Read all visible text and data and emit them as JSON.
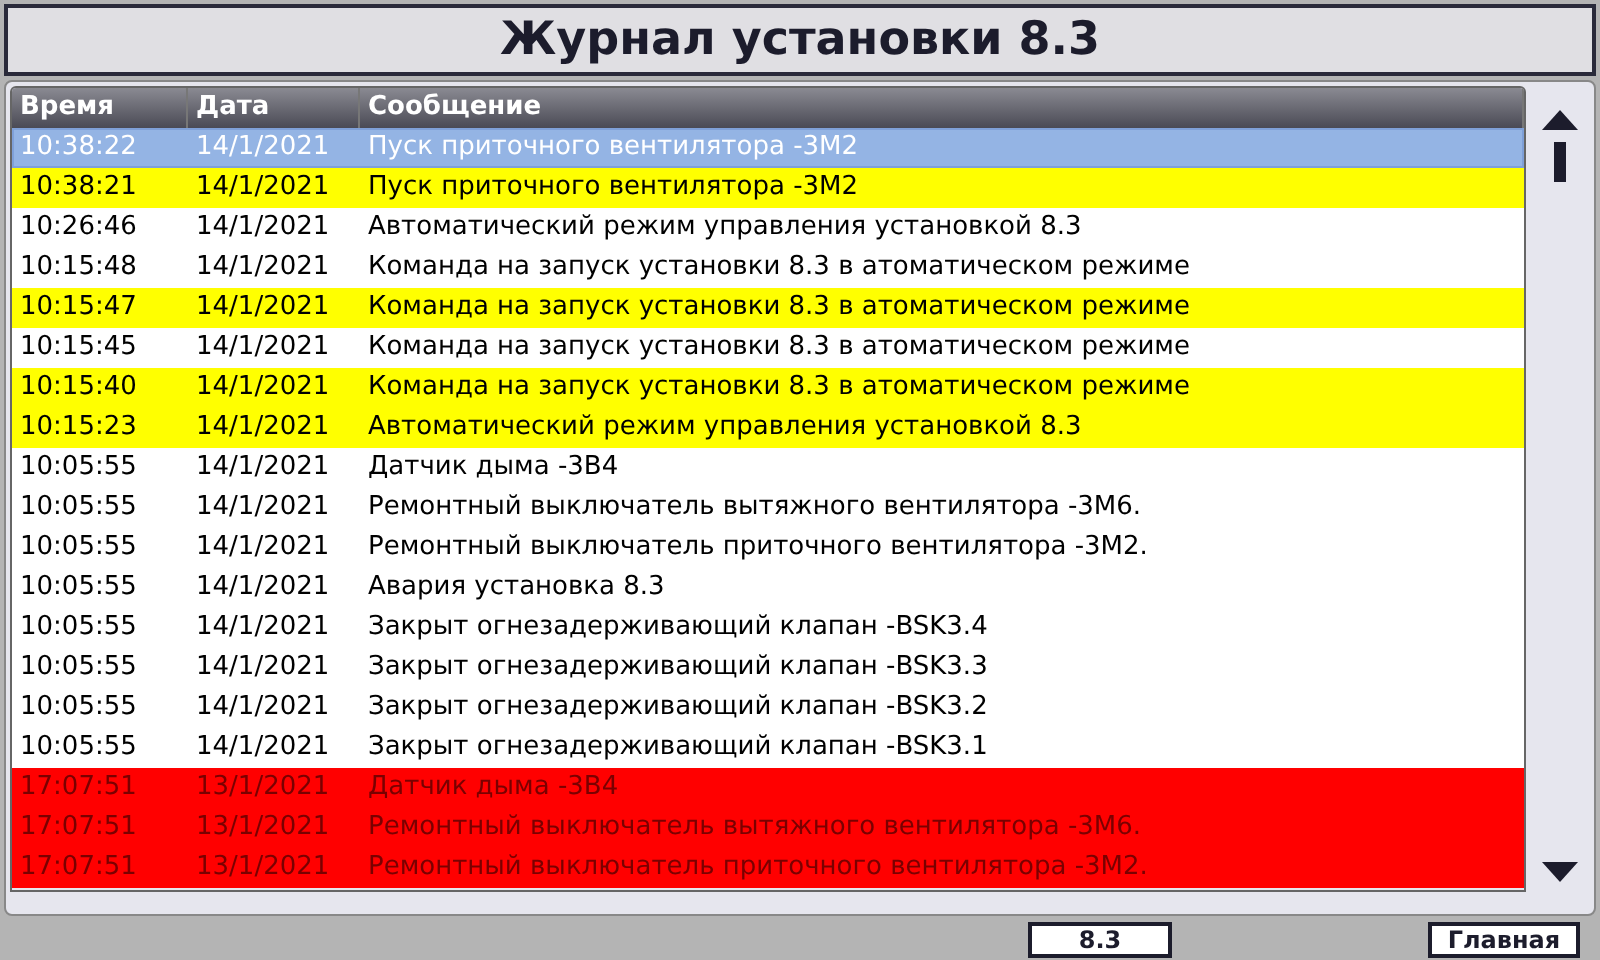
{
  "window": {
    "title": "Журнал установки 8.3"
  },
  "table": {
    "columns": [
      "Время",
      "Дата",
      "Сообщение"
    ],
    "rows": [
      {
        "cells": [
          "10:38:22",
          "14/1/2021",
          "Пуск приточного вентилятора -3М2"
        ],
        "selected": true,
        "color": "#94b4e4"
      },
      {
        "cells": [
          "10:38:21",
          "14/1/2021",
          "Пуск приточного вентилятора -3М2"
        ],
        "selected": false,
        "color": "#ffff00"
      },
      {
        "cells": [
          "10:26:46",
          "14/1/2021",
          "Автоматический режим управления установкой 8.3"
        ],
        "selected": false,
        "color": "#ffffff"
      },
      {
        "cells": [
          "10:15:48",
          "14/1/2021",
          "Команда на запуск установки 8.3 в атоматическом режиме"
        ],
        "selected": false,
        "color": "#ffffff"
      },
      {
        "cells": [
          "10:15:47",
          "14/1/2021",
          "Команда на запуск установки 8.3 в атоматическом режиме"
        ],
        "selected": false,
        "color": "#ffff00"
      },
      {
        "cells": [
          "10:15:45",
          "14/1/2021",
          "Команда на запуск установки 8.3 в атоматическом режиме"
        ],
        "selected": false,
        "color": "#ffffff"
      },
      {
        "cells": [
          "10:15:40",
          "14/1/2021",
          "Команда на запуск установки 8.3 в атоматическом режиме"
        ],
        "selected": false,
        "color": "#ffff00"
      },
      {
        "cells": [
          "10:15:23",
          "14/1/2021",
          "Автоматический режим управления установкой 8.3"
        ],
        "selected": false,
        "color": "#ffff00"
      },
      {
        "cells": [
          "10:05:55",
          "14/1/2021",
          "Датчик дыма -3B4"
        ],
        "selected": false,
        "color": "#ffffff"
      },
      {
        "cells": [
          "10:05:55",
          "14/1/2021",
          "Ремонтный выключатель вытяжного вентилятора -3М6."
        ],
        "selected": false,
        "color": "#ffffff"
      },
      {
        "cells": [
          "10:05:55",
          "14/1/2021",
          "Ремонтный выключатель приточного вентилятора -3М2."
        ],
        "selected": false,
        "color": "#ffffff"
      },
      {
        "cells": [
          "10:05:55",
          "14/1/2021",
          "Авария установка 8.3"
        ],
        "selected": false,
        "color": "#ffffff"
      },
      {
        "cells": [
          "10:05:55",
          "14/1/2021",
          "Закрыт огнезадерживающий клапан -BSK3.4"
        ],
        "selected": false,
        "color": "#ffffff"
      },
      {
        "cells": [
          "10:05:55",
          "14/1/2021",
          "Закрыт огнезадерживающий клапан -BSK3.3"
        ],
        "selected": false,
        "color": "#ffffff"
      },
      {
        "cells": [
          "10:05:55",
          "14/1/2021",
          "Закрыт огнезадерживающий клапан -BSK3.2"
        ],
        "selected": false,
        "color": "#ffffff"
      },
      {
        "cells": [
          "10:05:55",
          "14/1/2021",
          "Закрыт огнезадерживающий клапан -BSK3.1"
        ],
        "selected": false,
        "color": "#ffffff"
      },
      {
        "cells": [
          "17:07:51",
          "13/1/2021",
          "Датчик дыма -3B4"
        ],
        "selected": false,
        "color": "#ff0000"
      },
      {
        "cells": [
          "17:07:51",
          "13/1/2021",
          "Ремонтный выключатель вытяжного вентилятора -3М6."
        ],
        "selected": false,
        "color": "#ff0000"
      },
      {
        "cells": [
          "17:07:51",
          "13/1/2021",
          "Ремонтный выключатель приточного вентилятора -3М2."
        ],
        "selected": false,
        "color": "#ff0000"
      }
    ]
  },
  "buttons": [
    "8.3",
    "Главная"
  ]
}
